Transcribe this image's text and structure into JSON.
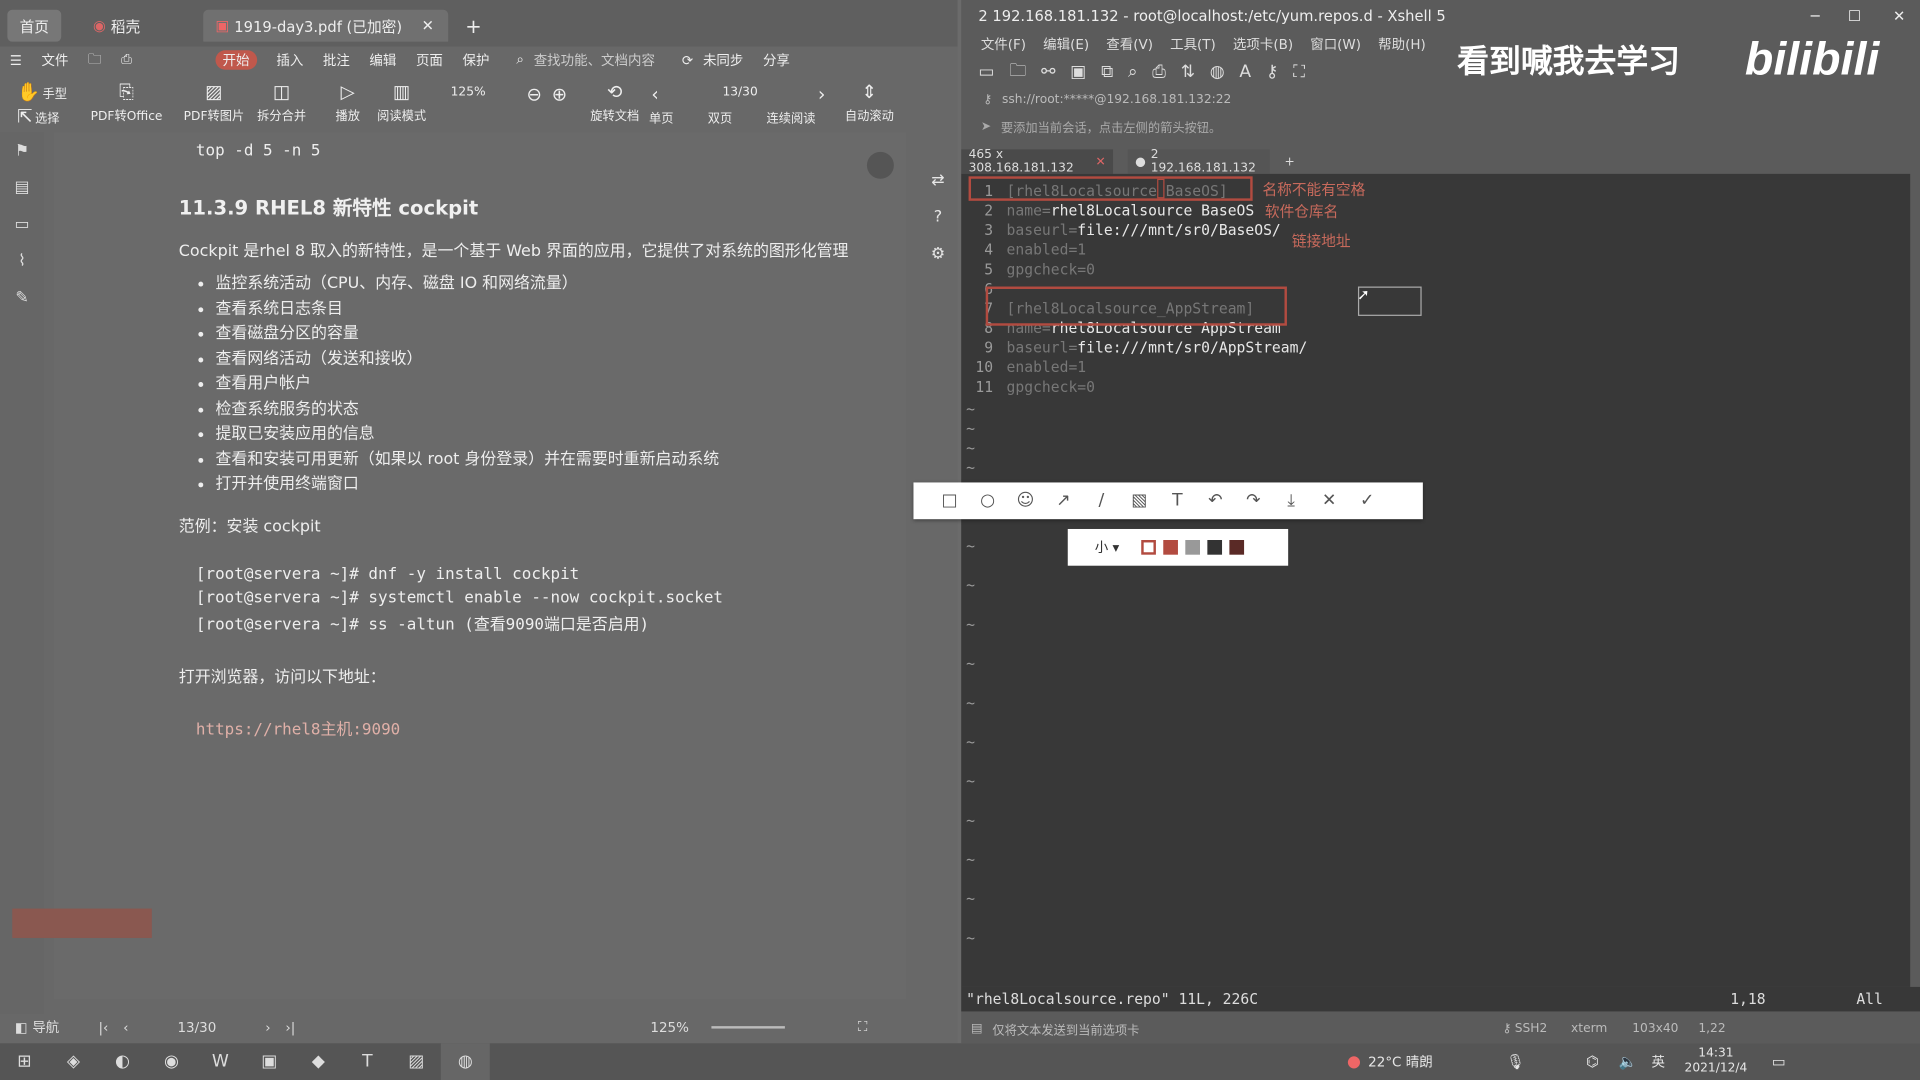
{
  "pdf": {
    "tabs": {
      "home": "首页",
      "daoke": "稻壳",
      "doc": "1919-day3.pdf (已加密)"
    },
    "menu": [
      "文件",
      "开始",
      "插入",
      "批注",
      "编辑",
      "页面",
      "保护"
    ],
    "search_placeholder": "查找功能、文档内容",
    "sync": "未同步",
    "share": "分享",
    "ribbon": [
      "手型",
      "选择",
      "PDF转Office",
      "PDF转图片",
      "拆分合并",
      "播放",
      "阅读模式",
      "125%",
      "13/30",
      "旋转文档",
      "单页",
      "双页",
      "连续阅读",
      "自动滚动"
    ],
    "cmd_top": "top -d 5 -n 5",
    "heading": "11.3.9 RHEL8 新特性 cockpit",
    "intro": "Cockpit 是rhel 8 取入的新特性，是一个基于 Web 界面的应用，它提供了对系统的图形化管理",
    "features": [
      "监控系统活动（CPU、内存、磁盘 IO 和网络流量）",
      "查看系统日志条目",
      "查看磁盘分区的容量",
      "查看网络活动（发送和接收）",
      "查看用户帐户",
      "检查系统服务的状态",
      "提取已安装应用的信息",
      "查看和安装可用更新（如果以 root 身份登录）并在需要时重新启动系统",
      "打开并使用终端窗口"
    ],
    "example": "范例：安装 cockpit",
    "cmds": [
      "[root@servera ~]# dnf -y install cockpit",
      "[root@servera ~]# systemctl enable --now cockpit.socket",
      "[root@servera ~]# ss -altun (查看9090端口是否启用)"
    ],
    "browser": "打开浏览器，访问以下地址：",
    "url": "https://rhel8主机:9090",
    "status": {
      "nav": "导航",
      "page": "13/30",
      "zoom": "125%"
    }
  },
  "xshell": {
    "title": "2 192.168.181.132 - root@localhost:/etc/yum.repos.d - Xshell 5",
    "menu": [
      "文件(F)",
      "编辑(E)",
      "查看(V)",
      "工具(T)",
      "选项卡(B)",
      "窗口(W)",
      "帮助(H)"
    ],
    "address": "ssh://root:*****@192.168.181.132:22",
    "hint": "要添加当前会话，点击左侧的箭头按钮。",
    "tab1": "465 x 308.168.181.132",
    "tab2": "2 192.168.181.132",
    "lines": [
      {
        "n": "1",
        "a": "[rhel8Localsource_BaseOS]",
        "b": ""
      },
      {
        "n": "2",
        "a": "name=",
        "b": "rhel8Localsource BaseOS"
      },
      {
        "n": "3",
        "a": "baseurl=",
        "b": "file:///mnt/sr0/BaseOS/"
      },
      {
        "n": "4",
        "a": "enabled=1",
        "b": ""
      },
      {
        "n": "5",
        "a": "gpgcheck=0",
        "b": ""
      },
      {
        "n": "6",
        "a": "",
        "b": ""
      },
      {
        "n": "7",
        "a": "[rhel8Localsource_AppStream]",
        "b": ""
      },
      {
        "n": "8",
        "a": "name=",
        "b": "rhel8Localsource AppStream"
      },
      {
        "n": "9",
        "a": "baseurl=",
        "b": "file:///mnt/sr0/AppStream/"
      },
      {
        "n": "10",
        "a": "enabled=1",
        "b": ""
      },
      {
        "n": "11",
        "a": "gpgcheck=0",
        "b": ""
      }
    ],
    "ann1": "名称不能有空格",
    "ann2": "软件仓库名",
    "ann3": "链接地址",
    "status_file": "\"rhel8Localsource.repo\" 11L, 226C",
    "status_pos": "1,18",
    "status_all": "All",
    "bottom_hint": "仅将文本发送到当前选项卡",
    "bottom_info": [
      "SSH2",
      "xterm",
      "103x40",
      "1,22"
    ]
  },
  "snip": {
    "size": "小 ▾"
  },
  "watermark": "看到喊我去学习",
  "bili": "bilibili",
  "taskbar": {
    "weather": "22°C 晴朗",
    "time": "14:31",
    "date": "2021/12/4",
    "ime": "英"
  }
}
